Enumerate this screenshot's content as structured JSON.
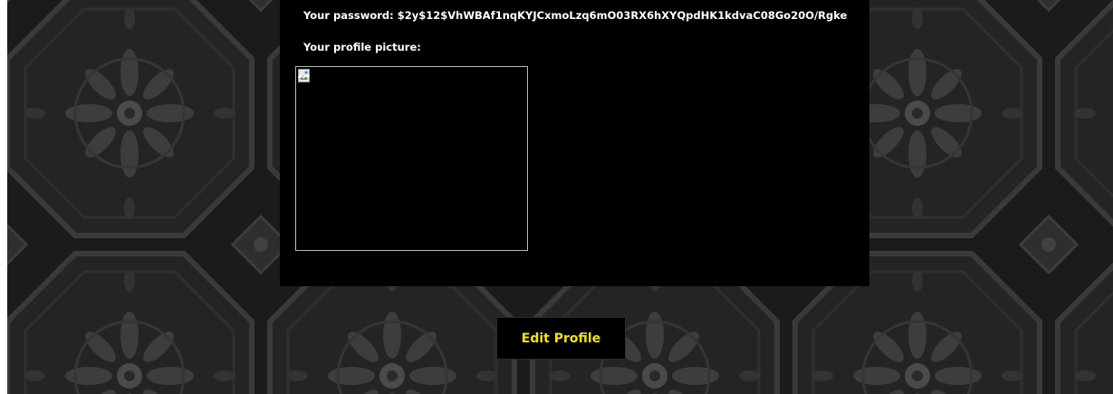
{
  "profile": {
    "password_text": "Your password: $2y$12$VhWBAf1nqKYJCxmoLzq6mO03RX6hXYQpdHK1kdvaC08Go20O/Rgke",
    "picture_label": "Your profile picture:",
    "picture_icon": "broken-image-icon"
  },
  "actions": {
    "edit_profile_label": "Edit Profile"
  },
  "colors": {
    "background_pattern": "#1a1a1a",
    "panel": "#000000",
    "text": "#ffffff",
    "button_text": "#f5e11a"
  }
}
